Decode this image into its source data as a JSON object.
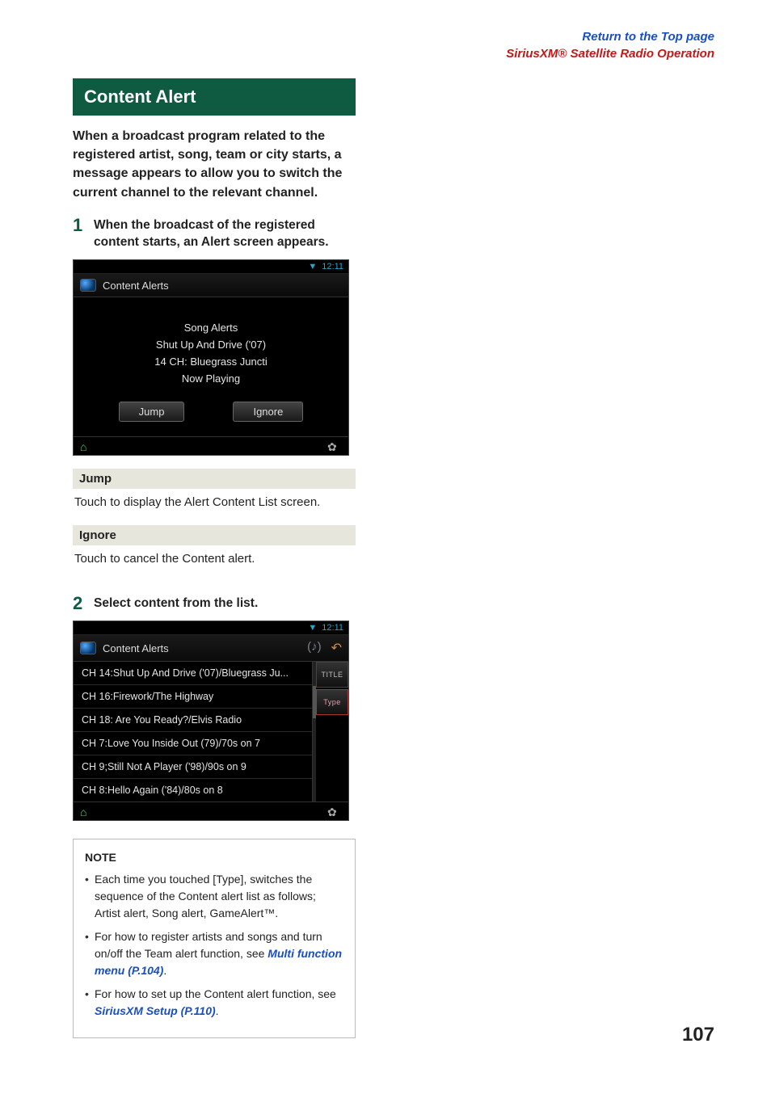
{
  "header": {
    "top_link": "Return to the Top page",
    "breadcrumb": "SiriusXM® Satellite Radio Operation"
  },
  "section_title": "Content Alert",
  "intro": "When a broadcast program related to the registered artist, song, team or city starts, a message appears to allow you to switch the current channel to the relevant channel.",
  "steps": {
    "s1_num": "1",
    "s1_text": "When the broadcast of the registered content starts, an Alert screen appears.",
    "s2_num": "2",
    "s2_text": "Select content from the list."
  },
  "device1": {
    "time": "12:11",
    "title": "Content Alerts",
    "line1": "Song Alerts",
    "line2": "Shut Up And Drive ('07)",
    "line3": "14 CH: Bluegrass Juncti",
    "line4": "Now Playing",
    "btn_jump": "Jump",
    "btn_ignore": "Ignore"
  },
  "labels": {
    "jump_title": "Jump",
    "jump_desc": "Touch to display the Alert Content List screen.",
    "ignore_title": "Ignore",
    "ignore_desc": "Touch to cancel the Content alert."
  },
  "device2": {
    "time": "12:11",
    "title": "Content Alerts",
    "side_title": "TITLE",
    "side_type": "Type",
    "rows": [
      "CH 14:Shut Up And Drive ('07)/Bluegrass Ju...",
      "CH 16:Firework/The Highway",
      "CH 18: Are You Ready?/Elvis Radio",
      "CH 7:Love You Inside Out (79)/70s on 7",
      "CH 9;Still Not A Player ('98)/90s on 9",
      "CH 8:Hello Again ('84)/80s on 8"
    ]
  },
  "note": {
    "title": "NOTE",
    "item1": "Each time you touched [Type], switches the sequence of the Content alert list as follows; Artist alert, Song alert, GameAlert™.",
    "item2_pre": "For how to register artists and songs and turn on/off the Team alert function, see ",
    "item2_link": "Multi function menu (P.104)",
    "item2_post": ".",
    "item3_pre": "For how to set up the Content alert function, see ",
    "item3_link": "SiriusXM Setup (P.110)",
    "item3_post": "."
  },
  "page_number": "107"
}
